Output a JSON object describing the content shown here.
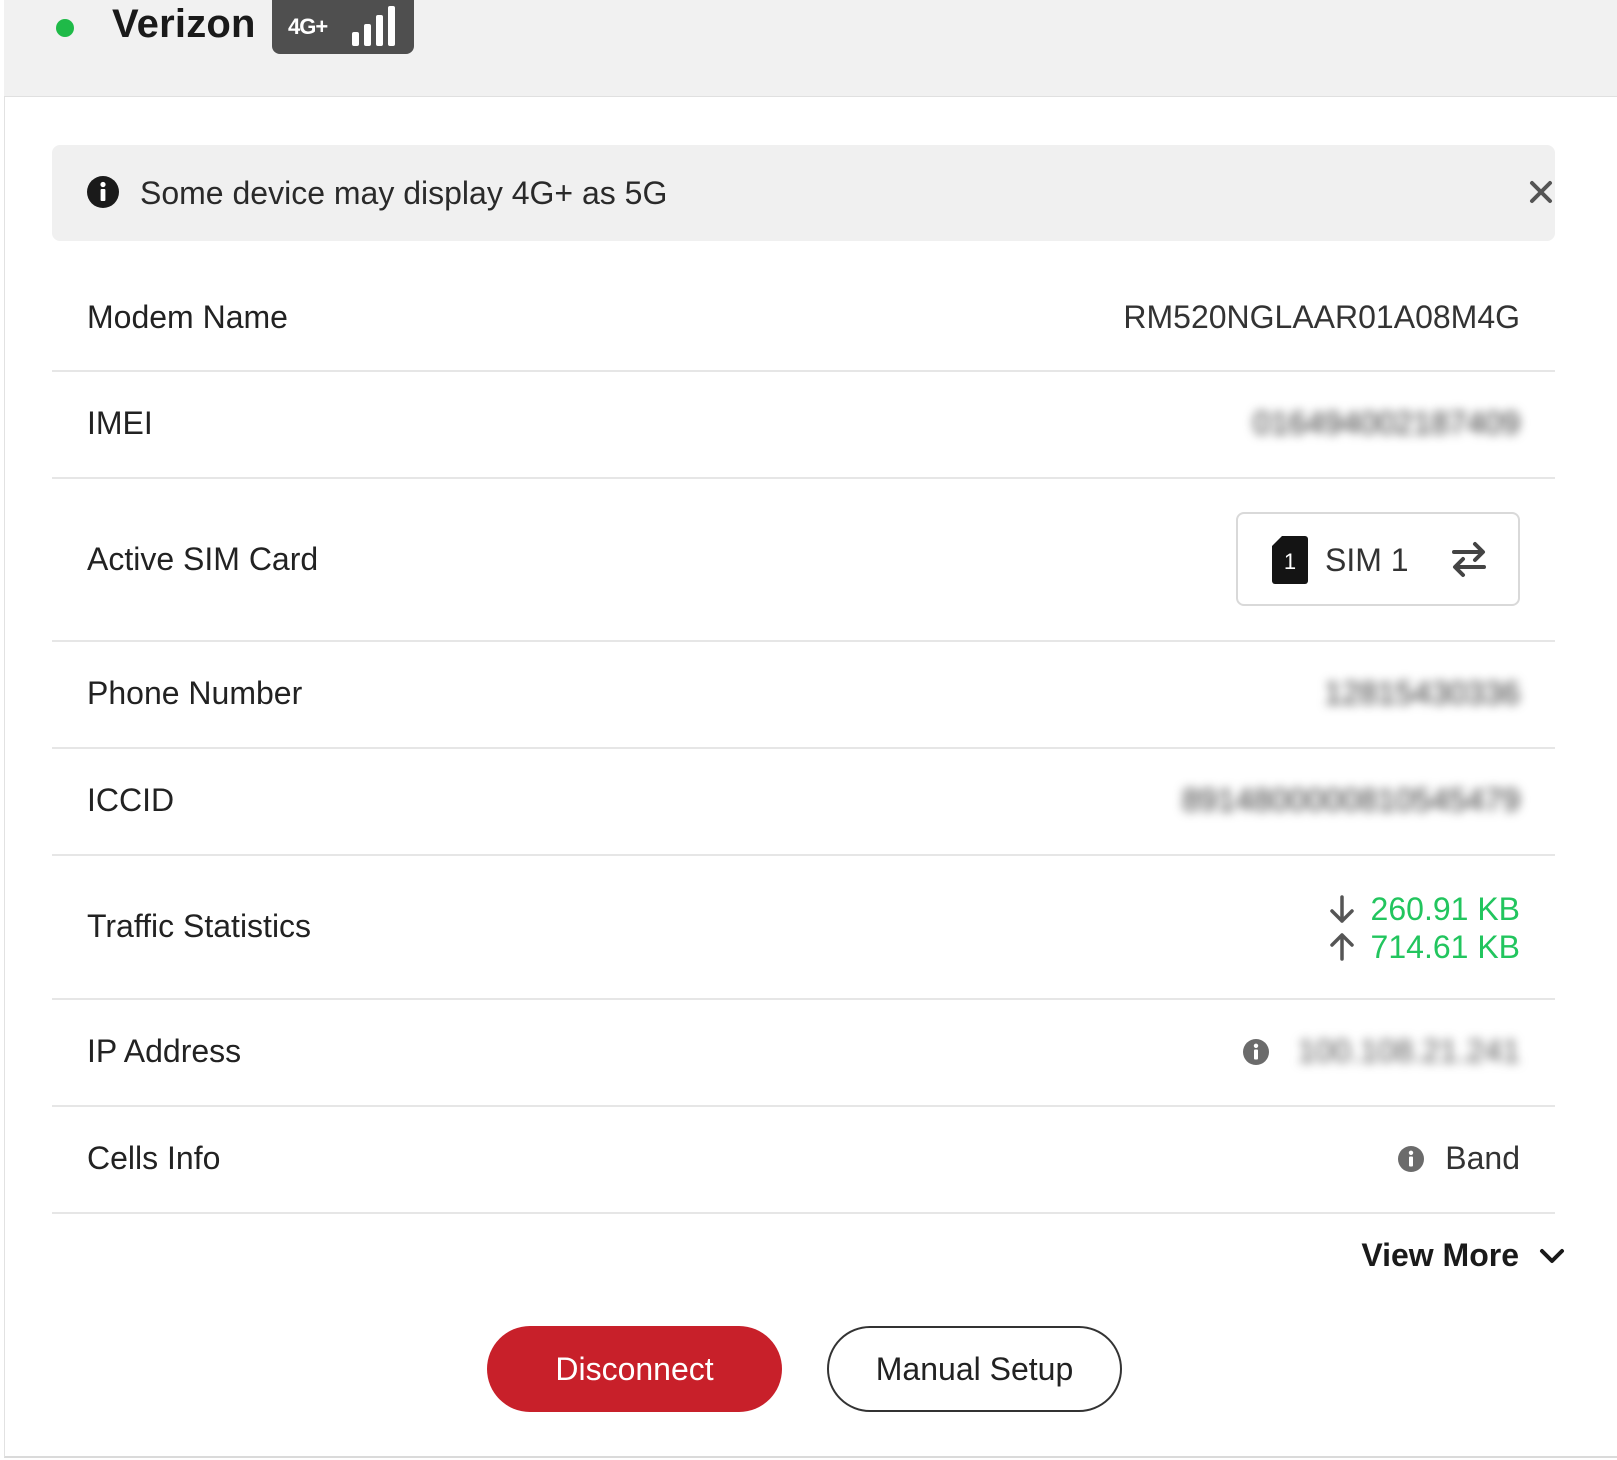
{
  "header": {
    "carrier_name": "Verizon",
    "network_type": "4G+",
    "status_color": "#1fba48"
  },
  "notice": {
    "text": "Some device may display 4G+ as 5G",
    "icon": "info-circle-icon",
    "close_icon": "close-icon"
  },
  "rows": {
    "modem_name": {
      "label": "Modem Name",
      "value": "RM520NGLAAR01A08M4G"
    },
    "imei": {
      "label": "IMEI",
      "value": "016494002187409"
    },
    "active_sim": {
      "label": "Active SIM Card",
      "sim_number": "1",
      "sim_label": "SIM 1",
      "swap_icon": "swap-arrows-icon"
    },
    "phone_number": {
      "label": "Phone Number",
      "value": "12815430336"
    },
    "iccid": {
      "label": "ICCID",
      "value": "8914800000810545479"
    },
    "traffic": {
      "label": "Traffic Statistics",
      "download": "260.91 KB",
      "upload": "714.61 KB",
      "color": "#22c55e"
    },
    "ip_address": {
      "label": "IP Address",
      "value": "100.108.21.241"
    },
    "cells_info": {
      "label": "Cells Info",
      "value": "Band"
    }
  },
  "view_more": {
    "label": "View More",
    "icon": "chevron-down-icon"
  },
  "buttons": {
    "disconnect": "Disconnect",
    "manual_setup": "Manual Setup",
    "accent": "#c8202a"
  }
}
